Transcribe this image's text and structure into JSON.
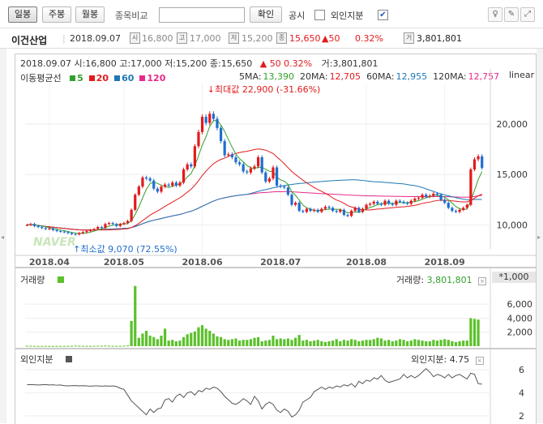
{
  "toolbar": {
    "periods": [
      "일봉",
      "주봉",
      "월봉"
    ],
    "compare_label": "종목비교",
    "compare_value": "",
    "confirm_label": "확인",
    "disclosure_label": "공시",
    "foreign_label": "외인지분",
    "foreign_checked": true
  },
  "stock": {
    "name": "이건산업",
    "date": "2018.09.07",
    "open": "16,800",
    "high": "17,000",
    "low": "15,200",
    "close": "15,650",
    "change": "▲50",
    "change_pct": "0.32%",
    "volume": "3,801,801",
    "icon_labels": [
      "시",
      "고",
      "저",
      "종",
      "거"
    ]
  },
  "chart_header": {
    "line": "2018.09.07 시:16,800 고:17,000 저:15,200 종:15,650",
    "change": "▲ 50 0.32%",
    "volume": "거:3,801,801",
    "ma_label": "이동평균선",
    "ma_items": [
      {
        "label": "5",
        "color": "#33a02c"
      },
      {
        "label": "20",
        "color": "#e31a1c"
      },
      {
        "label": "60",
        "color": "#1f78b4"
      },
      {
        "label": "120",
        "color": "#e7298a"
      }
    ],
    "ma_values": [
      {
        "name": "5MA:",
        "value": "13,390",
        "color": "#33a02c"
      },
      {
        "name": "20MA:",
        "value": "12,705",
        "color": "#e31a1c"
      },
      {
        "name": "60MA:",
        "value": "12,955",
        "color": "#1f78b4"
      },
      {
        "name": "120MA:",
        "value": "12,757",
        "color": "#e7298a"
      }
    ],
    "scale_label": "linear",
    "max_label": "최대값 22,900 (-31.66%)",
    "min_label": "최소값 9,070 (72.55%)",
    "watermark": "NAVER"
  },
  "volume_panel": {
    "title": "거래량",
    "value_label": "거래량:",
    "value": "3,801,801",
    "multiplier": "*1,000"
  },
  "foreign_panel": {
    "title": "외인지분",
    "value_label": "외인지분:",
    "value": "4.75"
  },
  "colors": {
    "up": "#e31a1c",
    "down": "#1f6ecf",
    "volume": "#5cc12b",
    "ma5": "#33a02c",
    "ma20": "#e31a1c",
    "ma60": "#1f78b4",
    "ma120": "#e7298a"
  },
  "chart_data": {
    "type": "candlestick",
    "x_ticks": [
      "2018.04",
      "2018.05",
      "2018.06",
      "2018.07",
      "2018.08",
      "2018.09"
    ],
    "x_tick_index": [
      6,
      26,
      47,
      68,
      91,
      112
    ],
    "price_ticks": [
      "20,000",
      "15,000",
      "10,000"
    ],
    "price_tick_values": [
      20000,
      15000,
      10000
    ],
    "y_range": [
      8600,
      24000
    ],
    "close": [
      10000,
      10100,
      9900,
      9800,
      9700,
      9600,
      9650,
      9500,
      9400,
      9350,
      9300,
      9200,
      9100,
      9070,
      9200,
      9300,
      9400,
      9500,
      9600,
      9800,
      9700,
      10100,
      10200,
      10100,
      9900,
      10100,
      10200,
      10400,
      11500,
      13000,
      13800,
      14700,
      14600,
      14400,
      13600,
      13300,
      13800,
      14000,
      13900,
      14200,
      13900,
      14200,
      15500,
      16000,
      15800,
      17800,
      19200,
      20700,
      20100,
      21000,
      20500,
      19600,
      18300,
      16900,
      17000,
      16700,
      16200,
      16000,
      15300,
      15200,
      15600,
      15800,
      16700,
      15200,
      14300,
      14600,
      15700,
      13900,
      13800,
      13700,
      13000,
      12000,
      12200,
      11400,
      11300,
      11600,
      11400,
      11500,
      11300,
      11600,
      11800,
      11700,
      11400,
      11300,
      11500,
      11000,
      10900,
      11400,
      11700,
      11300,
      11600,
      12000,
      12100,
      12300,
      12100,
      12000,
      12400,
      12100,
      12000,
      12400,
      12300,
      12200,
      12100,
      12400,
      12600,
      12700,
      13000,
      12800,
      12900,
      13100,
      13000,
      12500,
      12200,
      11700,
      11400,
      11300,
      11500,
      11700,
      12000,
      15500,
      16500,
      16800,
      15650
    ],
    "volume": [
      60,
      50,
      40,
      30,
      30,
      40,
      30,
      30,
      40,
      30,
      30,
      40,
      50,
      80,
      60,
      50,
      40,
      40,
      60,
      70,
      60,
      80,
      70,
      50,
      40,
      60,
      70,
      100,
      3600,
      8600,
      1200,
      1800,
      2200,
      1500,
      1300,
      1000,
      1500,
      2500,
      800,
      900,
      700,
      800,
      1300,
      1700,
      1900,
      2100,
      2700,
      3000,
      2500,
      2200,
      1800,
      1400,
      1300,
      1000,
      900,
      1000,
      1100,
      800,
      900,
      900,
      1000,
      1200,
      1300,
      700,
      800,
      900,
      1500,
      1000,
      1100,
      1000,
      1100,
      900,
      1200,
      1600,
      800,
      900,
      700,
      800,
      900,
      700,
      600,
      700,
      800,
      1000,
      700,
      900,
      800,
      1000,
      900,
      700,
      800,
      900,
      900,
      1000,
      1200,
      1100,
      800,
      900,
      700,
      800,
      1000,
      900,
      700,
      800,
      1000,
      900,
      800,
      700,
      700,
      900,
      800,
      900,
      1000,
      900,
      700,
      600,
      700,
      800,
      800,
      4000,
      3900,
      3800
    ],
    "foreign": [
      4.7,
      4.72,
      4.7,
      4.68,
      4.7,
      4.72,
      4.68,
      4.7,
      4.66,
      4.68,
      4.62,
      4.6,
      4.62,
      4.63,
      4.6,
      4.62,
      4.6,
      4.58,
      4.6,
      4.6,
      4.58,
      4.6,
      4.58,
      4.6,
      4.55,
      4.4,
      4.3,
      3.8,
      3.3,
      3.0,
      2.7,
      2.4,
      2.1,
      2.6,
      2.3,
      2.6,
      2.7,
      3.4,
      3.5,
      3.2,
      3.7,
      3.9,
      3.6,
      4.0,
      4.1,
      3.8,
      4.2,
      4.1,
      4.4,
      4.3,
      4.5,
      4.4,
      4.1,
      3.7,
      3.4,
      3.1,
      3.0,
      3.2,
      3.5,
      3.3,
      3.0,
      3.7,
      3.3,
      2.6,
      3.0,
      3.2,
      3.0,
      2.5,
      2.3,
      2.6,
      2.4,
      1.9,
      2.1,
      2.5,
      3.2,
      3.4,
      3.6,
      4.1,
      4.3,
      4.5,
      4.3,
      4.5,
      4.4,
      4.6,
      4.5,
      4.7,
      4.6,
      4.8,
      4.5,
      5.0,
      4.8,
      5.1,
      5.0,
      5.3,
      5.2,
      5.5,
      5.1,
      4.9,
      5.0,
      5.1,
      5.2,
      5.6,
      5.3,
      5.5,
      5.3,
      5.5,
      5.8,
      6.1,
      5.8,
      5.4,
      5.6,
      5.5,
      5.3,
      5.6,
      5.3,
      5.5,
      5.6,
      5.4,
      5.2,
      5.7,
      5.6,
      4.8,
      4.75
    ],
    "volume_ticks": [
      "6,000",
      "4,000",
      "2,000"
    ],
    "volume_tick_values": [
      6000,
      4000,
      2000
    ],
    "foreign_ticks": [
      "6",
      "4",
      "2"
    ],
    "foreign_tick_values": [
      6,
      4,
      2
    ]
  }
}
